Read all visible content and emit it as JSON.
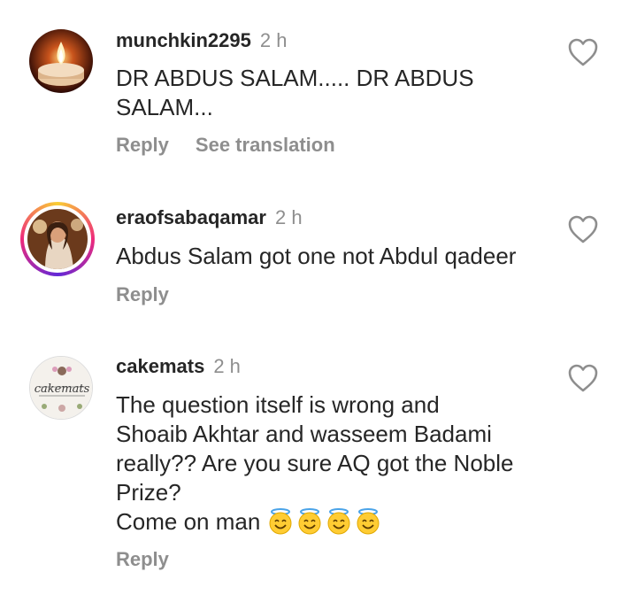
{
  "comments": [
    {
      "username": "munchkin2295",
      "time": "2 h",
      "text": "DR ABDUS SALAM..... DR ABDUS\nSALAM...",
      "reply": "Reply",
      "translate": "See translation",
      "avatar": "candle-photo"
    },
    {
      "username": "eraofsabaqamar",
      "time": "2 h",
      "text": "Abdus Salam got one not Abdul qadeer",
      "reply": "Reply",
      "avatar": "portrait-photo-story-ring"
    },
    {
      "username": "cakemats",
      "time": "2 h",
      "text": "The question itself is wrong and\nShoaib Akhtar and wasseem Badami\nreally?? Are you sure AQ got the Noble\nPrize?\nCome on man ",
      "reply": "Reply",
      "avatar_logo_text": "cakemats",
      "emojis": [
        "halo-smile-icon",
        "halo-smile-icon",
        "halo-smile-icon",
        "halo-smile-icon"
      ]
    }
  ],
  "colors": {
    "text": "#262626",
    "muted": "#8e8e8e",
    "heart": "#8e8e8e"
  }
}
